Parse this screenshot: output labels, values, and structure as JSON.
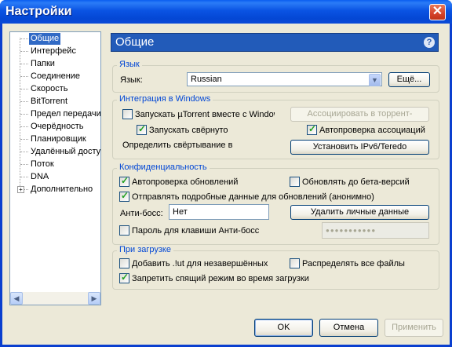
{
  "window": {
    "title": "Настройки",
    "close_glyph": "✕"
  },
  "tree": {
    "items": [
      {
        "label": "Общие",
        "selected": true
      },
      {
        "label": "Интерфейс"
      },
      {
        "label": "Папки"
      },
      {
        "label": "Соединение"
      },
      {
        "label": "Скорость"
      },
      {
        "label": "BitTorrent"
      },
      {
        "label": "Предел передачи"
      },
      {
        "label": "Очерёдность"
      },
      {
        "label": "Планировщик"
      },
      {
        "label": "Удалённый доступ"
      },
      {
        "label": "Поток"
      },
      {
        "label": "DNA"
      },
      {
        "label": "Дополнительно",
        "expandable": true
      }
    ],
    "expander_glyph": "+",
    "scroll_left": "◀",
    "scroll_right": "▶"
  },
  "panel": {
    "title": "Общие",
    "help_glyph": "?",
    "language": {
      "group_title": "Язык",
      "label": "Язык:",
      "value": "Russian",
      "more_button": "Ещё..."
    },
    "windows": {
      "group_title": "Интеграция в Windows",
      "start_with_windows": {
        "label": "Запускать µTorrent вместе с Windows",
        "checked": false
      },
      "start_minimized": {
        "label": "Запускать свёрнуто",
        "checked": true
      },
      "associate_button": "Ассоциировать в торрент-файлами",
      "auto_check_assoc": {
        "label": "Автопроверка ассоциаций",
        "checked": true
      },
      "minimize_label": "Определить свёртывание в",
      "ipv6_button": "Установить IPv6/Teredo"
    },
    "privacy": {
      "group_title": "Конфиденциальность",
      "auto_update": {
        "label": "Автопроверка обновлений",
        "checked": true
      },
      "beta_update": {
        "label": "Обновлять до бета-версий",
        "checked": false
      },
      "send_data": {
        "label": "Отправлять подробные данные для обновлений (анонимно)",
        "checked": true
      },
      "boss_label": "Анти-босс:",
      "boss_value": "Нет",
      "clear_button": "Удалить личные данные",
      "boss_password": {
        "label": "Пароль для клавиши Анти-босс",
        "checked": false
      },
      "password_value": "●●●●●●●●●●●"
    },
    "download": {
      "group_title": "При загрузке",
      "append_ut": {
        "label": "Добавить .!ut для незавершённых",
        "checked": false
      },
      "prealloc": {
        "label": "Распределять все файлы",
        "checked": false
      },
      "prevent_sleep": {
        "label": "Запретить спящий режим во время загрузки",
        "checked": true
      }
    }
  },
  "footer": {
    "ok": "OK",
    "cancel": "Отмена",
    "apply": "Применить"
  },
  "colors": {
    "accent": "#225bb9",
    "group_title": "#0046d5",
    "dialog_bg": "#ece9d8",
    "titlebar": "#0a53e3"
  }
}
